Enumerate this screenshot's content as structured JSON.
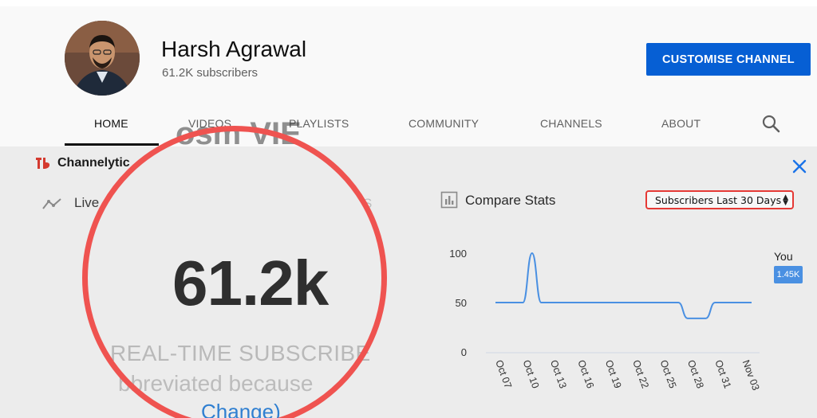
{
  "channel": {
    "name": "Harsh Agrawal",
    "subscribers": "61.2K subscribers",
    "customise_label": "CUSTOMISE CHANNEL"
  },
  "tabs": [
    {
      "label": "HOME",
      "active": true
    },
    {
      "label": "VIDEOS",
      "active": false
    },
    {
      "label": "PLAYLISTS",
      "active": false
    },
    {
      "label": "COMMUNITY",
      "active": false
    },
    {
      "label": "CHANNELS",
      "active": false
    },
    {
      "label": "ABOUT",
      "active": false
    }
  ],
  "extension": {
    "name": "Channelytic",
    "live_label": "Live",
    "faded_views": "osm VIE",
    "faded_tail": "S",
    "count": "61.2k",
    "realtime_label": "REAL-TIME SUBSCRIBE",
    "abbr_note": "bbreviated because",
    "change_link": "Change)",
    "compare_label": "Compare Stats",
    "select_value": "Subscribers Last 30 Days"
  },
  "colors": {
    "brand_blue": "#065fd4",
    "highlight_red": "#ef5350",
    "series_blue": "#4a90e2"
  },
  "chart_data": {
    "type": "line",
    "x": [
      "Oct 07",
      "Oct 08",
      "Oct 09",
      "Oct 10",
      "Oct 11",
      "Oct 12",
      "Oct 13",
      "Oct 14",
      "Oct 15",
      "Oct 16",
      "Oct 17",
      "Oct 18",
      "Oct 19",
      "Oct 20",
      "Oct 21",
      "Oct 22",
      "Oct 23",
      "Oct 24",
      "Oct 25",
      "Oct 26",
      "Oct 27",
      "Oct 28",
      "Oct 29",
      "Oct 30",
      "Oct 31",
      "Nov 01",
      "Nov 02",
      "Nov 03",
      "Nov 04"
    ],
    "series": [
      {
        "name": "You",
        "values": [
          50,
          50,
          50,
          50,
          100,
          50,
          50,
          50,
          50,
          50,
          50,
          50,
          50,
          50,
          50,
          50,
          50,
          50,
          50,
          50,
          50,
          34,
          34,
          34,
          50,
          50,
          50,
          50,
          50
        ]
      }
    ],
    "x_tick_labels": [
      "Oct 07",
      "Oct 10",
      "Oct 13",
      "Oct 16",
      "Oct 19",
      "Oct 22",
      "Oct 25",
      "Oct 28",
      "Oct 31",
      "Nov 03"
    ],
    "y_ticks": [
      0,
      50,
      100
    ],
    "ylim": [
      0,
      100
    ],
    "legend": {
      "label": "You",
      "badge": "1.45K",
      "placement": "right"
    },
    "grid": false
  }
}
